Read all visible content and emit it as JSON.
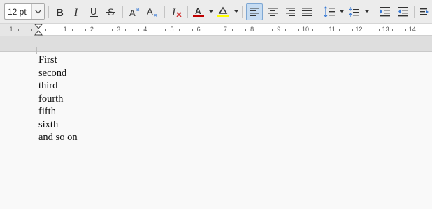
{
  "toolbar": {
    "font_size": "12 pt",
    "buttons": [
      {
        "name": "bold-button",
        "icon": "bold-icon"
      },
      {
        "name": "italic-button",
        "icon": "italic-icon"
      },
      {
        "name": "underline-button",
        "icon": "underline-icon"
      },
      {
        "name": "strikethrough-button",
        "icon": "strikethrough-icon"
      },
      {
        "name": "superscript-button",
        "icon": "superscript-icon"
      },
      {
        "name": "subscript-button",
        "icon": "subscript-icon"
      },
      {
        "name": "clear-formatting-button",
        "icon": "clear-formatting-icon"
      },
      {
        "name": "font-color-button",
        "icon": "font-color-icon"
      },
      {
        "name": "highlight-color-button",
        "icon": "highlight-icon"
      },
      {
        "name": "align-left-button",
        "icon": "align-left-icon",
        "active": true
      },
      {
        "name": "align-center-button",
        "icon": "align-center-icon"
      },
      {
        "name": "align-right-button",
        "icon": "align-right-icon"
      },
      {
        "name": "justify-button",
        "icon": "justify-icon"
      },
      {
        "name": "line-spacing-button",
        "icon": "line-spacing-icon"
      },
      {
        "name": "paragraph-spacing-button",
        "icon": "paragraph-spacing-icon"
      },
      {
        "name": "increase-indent-button",
        "icon": "increase-indent-icon"
      },
      {
        "name": "decrease-indent-button",
        "icon": "decrease-indent-icon"
      },
      {
        "name": "paragraph-direction-button",
        "icon": "paragraph-direction-icon"
      }
    ],
    "font_color": "#c00000",
    "highlight_color": "#ffff00",
    "active_bg": "#c6dcf2"
  },
  "ruler": {
    "labels": [
      "1",
      "1",
      "2",
      "3",
      "4",
      "5",
      "6",
      "7",
      "8",
      "9",
      "10",
      "11",
      "12",
      "13",
      "14"
    ]
  },
  "document": {
    "lines": [
      "First",
      "second",
      "third",
      "fourth",
      "fifth",
      "sixth",
      "and so on"
    ]
  }
}
